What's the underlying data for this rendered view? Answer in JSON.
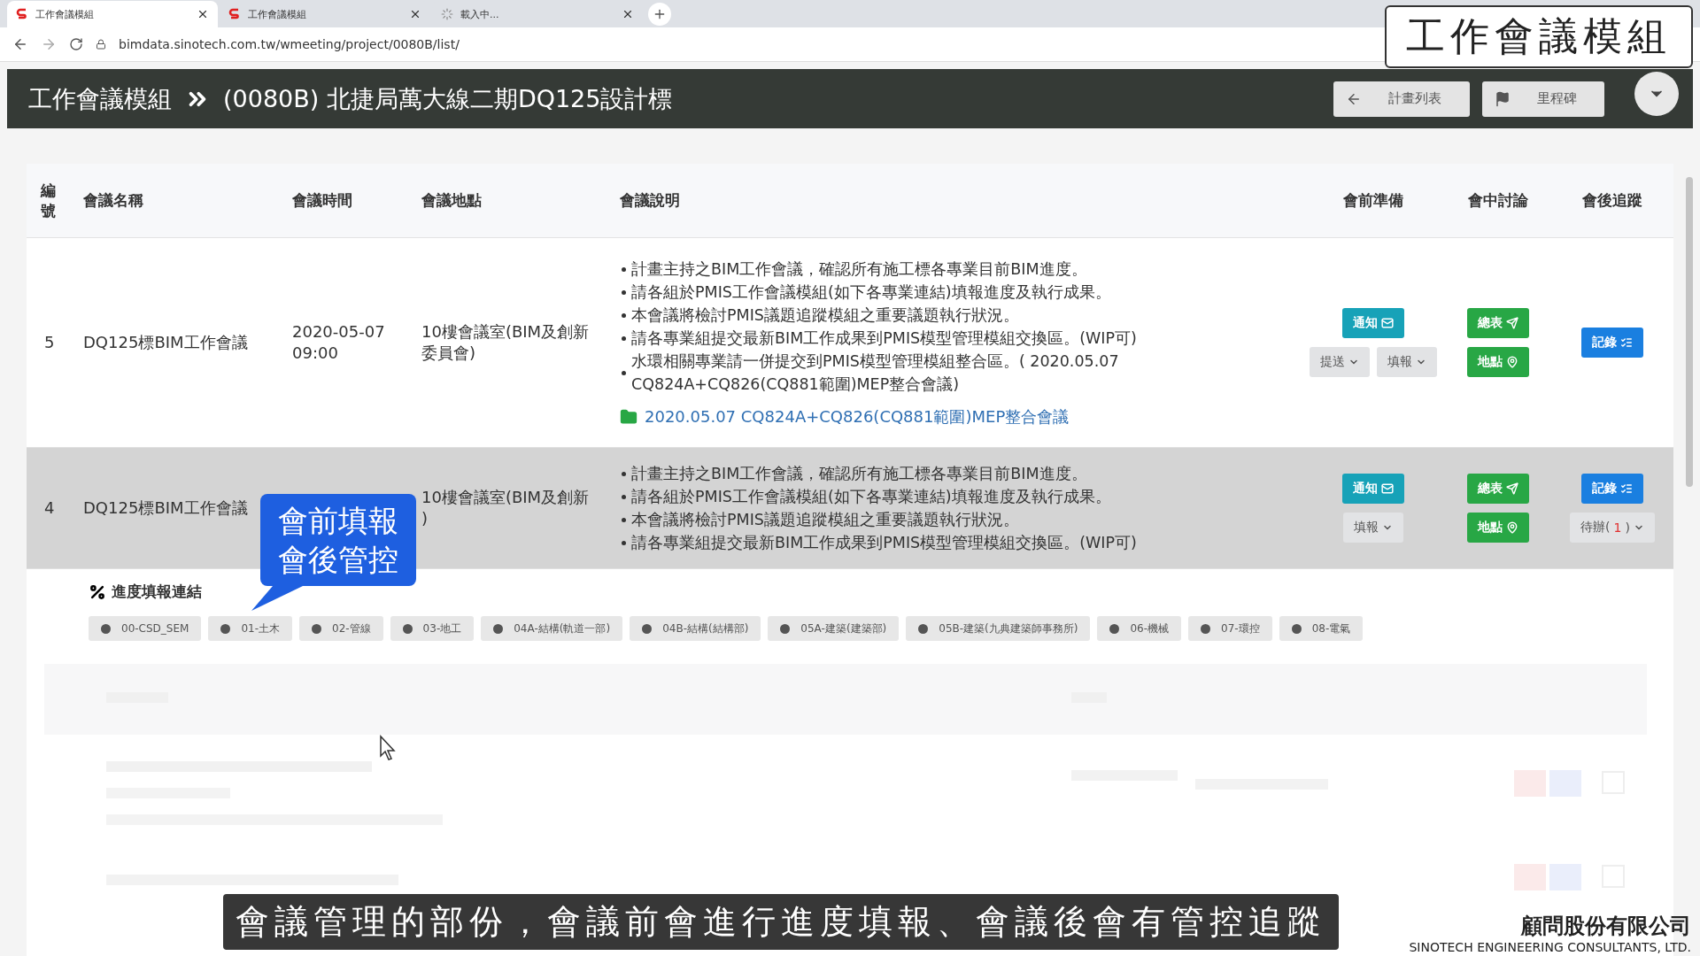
{
  "browser": {
    "tabs": [
      {
        "title": "工作會議模組",
        "selected": true,
        "kind": "site"
      },
      {
        "title": "工作會議模組",
        "selected": false,
        "kind": "site"
      },
      {
        "title": "載入中...",
        "selected": false,
        "kind": "loading"
      }
    ],
    "url": "bimdata.sinotech.com.tw/wmeeting/project/0080B/list/"
  },
  "header": {
    "title": "工作會議模組",
    "project": "(0080B) 北捷局萬大線二期DQ125設計標",
    "buttons": [
      {
        "label": "計畫列表",
        "kind": "back"
      },
      {
        "label": "里程碑",
        "kind": "flag"
      }
    ]
  },
  "overlay_label": "工作會議模組",
  "table": {
    "columns": [
      "編號",
      "會議名稱",
      "會議時間",
      "會議地點",
      "會議說明",
      "會前準備",
      "會中討論",
      "會後追蹤"
    ],
    "rows": [
      {
        "number": "5",
        "name": "DQ125標BIM工作會議",
        "time": "2020-05-07 09:00",
        "place": "10樓會議室(BIM及創新委員會)",
        "selected": false,
        "notes": [
          "計畫主持之BIM工作會議，確認所有施工標各專業目前BIM進度。",
          "請各組於PMIS工作會議模組(如下各專業連結)填報進度及執行成果。",
          "本會議將檢討PMIS議題追蹤模組之重要議題執行狀況。",
          "請各專業組提交最新BIM工作成果到PMIS模型管理模組交換區。(WIP可)",
          "水環相關專業請一併提交到PMIS模型管理模組整合區。( 2020.05.07 CQ824A+CQ826(CQ881範圍)MEP整合會議)"
        ],
        "link": "2020.05.07 CQ824A+CQ826(CQ881範圍)MEP整合會議",
        "pre": [
          {
            "label": "通知",
            "kind": "notify"
          },
          {
            "label": "提送",
            "kind": "dropdown"
          },
          {
            "label": "填報",
            "kind": "dropdown"
          }
        ],
        "mid": [
          {
            "label": "總表",
            "kind": "summary"
          },
          {
            "label": "地點",
            "kind": "location"
          }
        ],
        "post": [
          {
            "label": "記錄",
            "kind": "record"
          }
        ]
      },
      {
        "number": "4",
        "name": "DQ125標BIM工作會議",
        "place": "10樓會議室(BIM及創新",
        "place_2": ")",
        "selected": true,
        "notes": [
          "計畫主持之BIM工作會議，確認所有施工標各專業目前BIM進度。",
          "請各組於PMIS工作會議模組(如下各專業連結)填報進度及執行成果。",
          "本會議將檢討PMIS議題追蹤模組之重要議題執行狀況。",
          "請各專業組提交最新BIM工作成果到PMIS模型管理模組交換區。(WIP可)"
        ],
        "pre": [
          {
            "label": "通知",
            "kind": "notify"
          },
          {
            "label": "填報",
            "kind": "dropdown"
          }
        ],
        "mid": [
          {
            "label": "總表",
            "kind": "summary"
          },
          {
            "label": "地點",
            "kind": "location"
          }
        ],
        "post": [
          {
            "label": "記錄",
            "kind": "record"
          },
          {
            "label": "待辦(",
            "count": "1",
            "close": ")",
            "kind": "todo"
          }
        ]
      }
    ]
  },
  "progress_links": {
    "title": "進度填報連結",
    "chips": [
      "00-CSD_SEM",
      "01-土木",
      "02-管線",
      "03-地工",
      "04A-結構(軌道一部)",
      "04B-結構(結構部)",
      "05A-建築(建築部)",
      "05B-建築(九典建築師事務所)",
      "06-機械",
      "07-環控",
      "08-電氣"
    ]
  },
  "callout": [
    "會前填報",
    "會後管控"
  ],
  "caption": "會議管理的部份，會議前會進行進度填報、會議後會有管控追蹤",
  "logo": {
    "name": "顧問股份有限公司",
    "english": "SINOTECH ENGINEERING CONSULTANTS, LTD."
  }
}
